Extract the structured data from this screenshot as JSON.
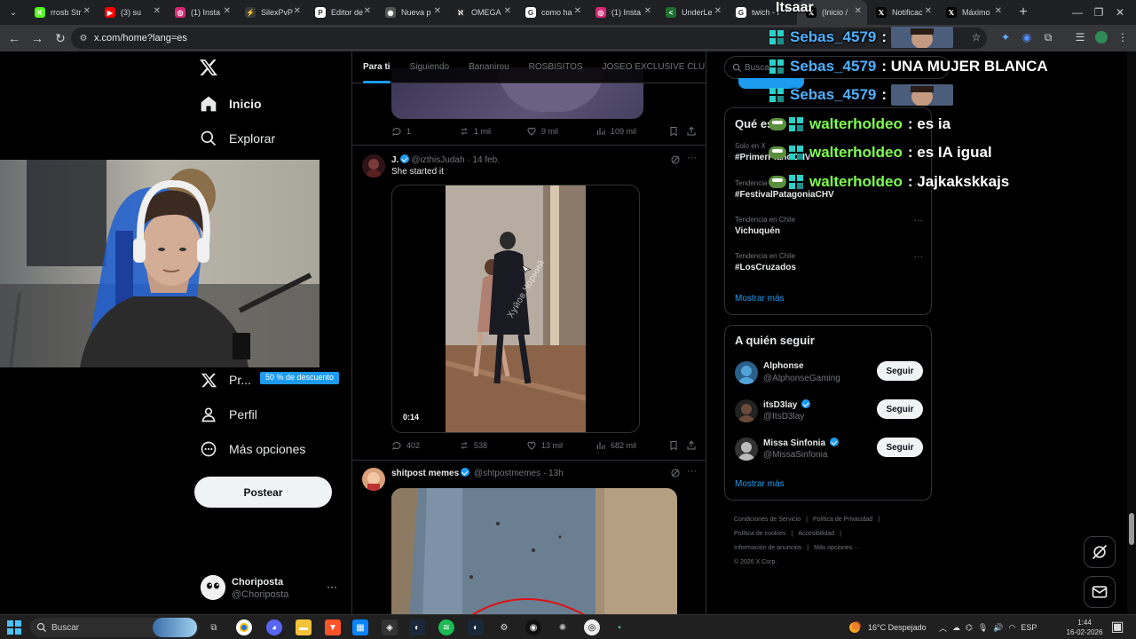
{
  "browser": {
    "tabs": [
      {
        "title": "rrosb Str",
        "fav": "K",
        "color": "#53fc18"
      },
      {
        "title": "(3) su",
        "fav": "▶",
        "color": "#ff0000"
      },
      {
        "title": "(1) Insta",
        "fav": "◎",
        "color": "#d62976"
      },
      {
        "title": "SilexPvP",
        "fav": "⚡",
        "color": "#3a3a3a"
      },
      {
        "title": "Editor de",
        "fav": "P",
        "color": "#ffffff"
      },
      {
        "title": "Nueva p",
        "fav": "◉",
        "color": "#555"
      },
      {
        "title": "OMEGA",
        "fav": "ℵ",
        "color": "#222"
      },
      {
        "title": "como ha",
        "fav": "G",
        "color": "#fff"
      },
      {
        "title": "(1) Insta",
        "fav": "◎",
        "color": "#d62976"
      },
      {
        "title": "UnderLe",
        "fav": "<",
        "color": "#1f6f2f"
      },
      {
        "title": "twich - I",
        "fav": "G",
        "color": "#fff"
      },
      {
        "title": "(Inicio /",
        "fav": "𝕏",
        "color": "#000"
      },
      {
        "title": "Notificac",
        "fav": "𝕏",
        "color": "#000"
      },
      {
        "title": "Máximo",
        "fav": "𝕏",
        "color": "#000"
      }
    ],
    "url": "x.com/home?lang=es"
  },
  "nav": {
    "inicio": "Inicio",
    "explorar": "Explorar",
    "premium": "Pr...",
    "premium_badge": "50 % de descuento",
    "perfil": "Perfil",
    "mas": "Más opciones",
    "post_button": "Postear",
    "account_name": "Choriposta",
    "account_handle": "@Choriposta"
  },
  "feed": {
    "tabs": [
      "Para ti",
      "Siguiendo",
      "Bananirou",
      "ROSBISITOS",
      "JOSEO EXCLUSIVE CLUB"
    ],
    "post0": {
      "replies": "1",
      "reposts": "1 mil",
      "likes": "9 mil",
      "views": "109 mil"
    },
    "post1": {
      "name": "J.",
      "handle": "@izthisJudah",
      "time": "· 14 feb.",
      "text": "She started it",
      "duration": "0:14",
      "watermark": "Хуйов Чорний",
      "replies": "402",
      "reposts": "538",
      "likes": "13 mil",
      "views": "682 mil"
    },
    "post2": {
      "name": "shitpost memes",
      "handle": "@shtpostmemes",
      "time": "· 13h"
    }
  },
  "right": {
    "search_placeholder": "Buscar",
    "trends_title": "Qué es",
    "trends": [
      {
        "cat": "Solo en X",
        "name": "#PrimerPlanoCHV"
      },
      {
        "cat": "Tendencia",
        "name": "#FestivalPatagoniaCHV"
      },
      {
        "cat": "Tendencia en Chile",
        "name": "Vichuquén"
      },
      {
        "cat": "Tendencia en Chile",
        "name": "#LosCruzados"
      }
    ],
    "trends_more": "Mostrar más",
    "follow_title": "A quién seguir",
    "follow": [
      {
        "name": "Alphonse",
        "handle": "@AlphonseGaming",
        "button": "Seguir",
        "verified": false
      },
      {
        "name": "itsD3lay",
        "handle": "@ItsD3lay",
        "button": "Seguir",
        "verified": true
      },
      {
        "name": "Missa Sinfonia",
        "handle": "@MissaSinfonia",
        "button": "Seguir",
        "verified": true
      }
    ],
    "follow_more": "Mostrar más",
    "footer": [
      "Condiciones de Servicio",
      "|",
      "Política de Privacidad",
      "|",
      "Política de cookies",
      "|",
      "Accesibilidad",
      "|",
      "Información de anuncios",
      "|",
      "Más opciones ···",
      "© 2026 X Corp."
    ]
  },
  "chat": {
    "title": "Itsaar",
    "lines": [
      {
        "user": "Sebas_4579",
        "msg": "",
        "emote": true,
        "color": "#4fb0ff"
      },
      {
        "user": "Sebas_4579",
        "msg": "UNA MUJER BLANCA",
        "emote": false,
        "color": "#4fb0ff"
      },
      {
        "user": "Sebas_4579",
        "msg": "",
        "emote": true,
        "color": "#4fb0ff"
      },
      {
        "user": "walterholdeo",
        "msg": "es ia",
        "emote": false,
        "color": "#7dff4f"
      },
      {
        "user": "walterholdeo",
        "msg": "es IA igual",
        "emote": false,
        "color": "#7dff4f"
      },
      {
        "user": "walterholdeo",
        "msg": "Jajkakskkajs",
        "emote": false,
        "color": "#7dff4f"
      }
    ]
  },
  "taskbar": {
    "search": "Buscar",
    "weather": "16°C  Despejado",
    "lang": "ESP",
    "time": "1:44",
    "date": "16-02-2026"
  },
  "colors": {
    "accent": "#1d9bf0",
    "background": "#000000",
    "border": "#2f3336"
  }
}
